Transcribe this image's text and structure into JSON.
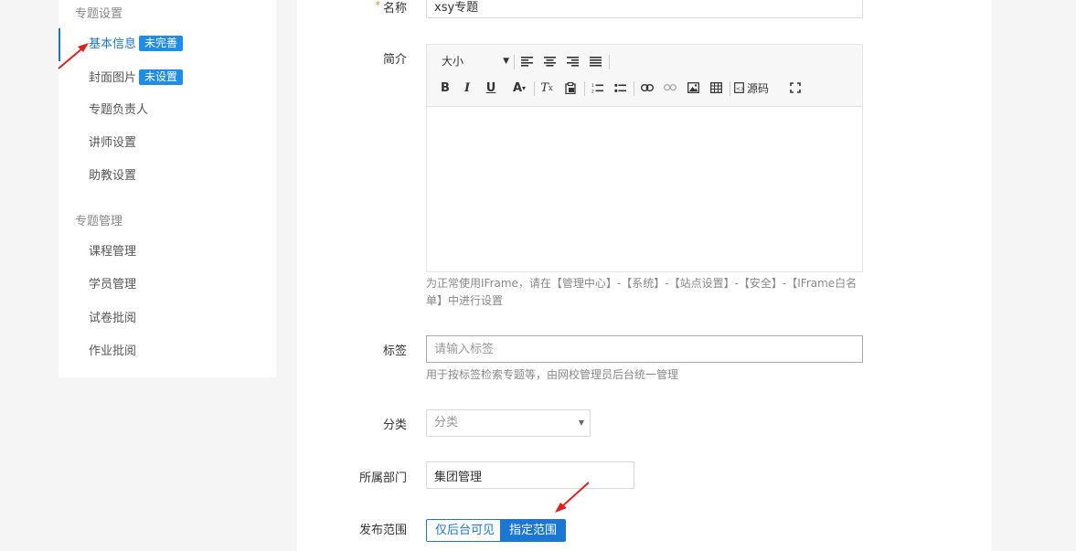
{
  "sidebar": {
    "group1_title": "专题设置",
    "items": [
      {
        "label": "基本信息",
        "tag": "未完善"
      },
      {
        "label": "封面图片",
        "tag": "未设置"
      },
      {
        "label": "专题负责人"
      },
      {
        "label": "讲师设置"
      },
      {
        "label": "助教设置"
      }
    ],
    "group2_title": "专题管理",
    "items2": [
      {
        "label": "课程管理"
      },
      {
        "label": "学员管理"
      },
      {
        "label": "试卷批阅"
      },
      {
        "label": "作业批阅"
      }
    ]
  },
  "form": {
    "name_label": "名称",
    "name_required": "*",
    "name_value": "xsy专题",
    "intro_label": "简介",
    "editor": {
      "size_label": "大小",
      "source_label": "源码",
      "help": "为正常使用IFrame，请在【管理中心】-【系统】-【站点设置】-【安全】-【IFrame白名单】中进行设置"
    },
    "tags_label": "标签",
    "tags_placeholder": "请输入标签",
    "tags_help": "用于按标签检索专题等，由网校管理员后台统一管理",
    "category_label": "分类",
    "category_placeholder": "分类",
    "dept_label": "所属部门",
    "dept_value": "集团管理",
    "scope_label": "发布范围",
    "scope_options": [
      "仅后台可见",
      "指定范围"
    ],
    "scope_selected": "指定范围"
  },
  "colors": {
    "accent": "#1a78d4",
    "tag_bg": "#1f8de6",
    "annotation_arrow": "#e02020"
  }
}
